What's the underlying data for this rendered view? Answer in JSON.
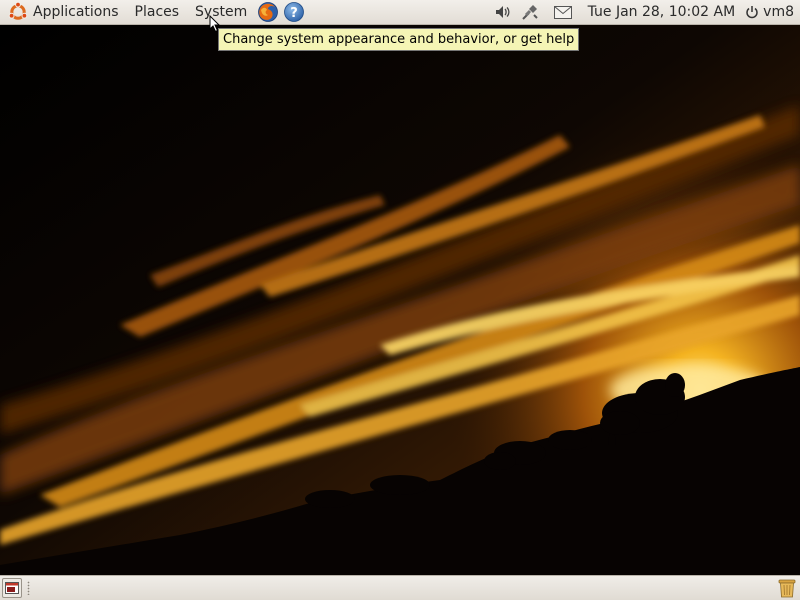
{
  "top_panel": {
    "menus": {
      "applications": "Applications",
      "places": "Places",
      "system": "System"
    },
    "launchers": [
      "firefox-icon",
      "help-icon"
    ],
    "tray_icons": [
      "volume-icon",
      "network-icon",
      "mail-icon"
    ],
    "clock": "Tue Jan 28, 10:02 AM",
    "user": "vm8"
  },
  "tooltip": {
    "text": "Change system appearance and behavior, or get help"
  },
  "bottom_panel": {
    "items": [
      "show-desktop-icon",
      "trash-icon"
    ]
  },
  "colors": {
    "panel_background": "#e9e5df",
    "tooltip_background": "#f5f5b5",
    "ubuntu_orange": "#dd4814",
    "sunset_gold": "#e8a11a"
  }
}
